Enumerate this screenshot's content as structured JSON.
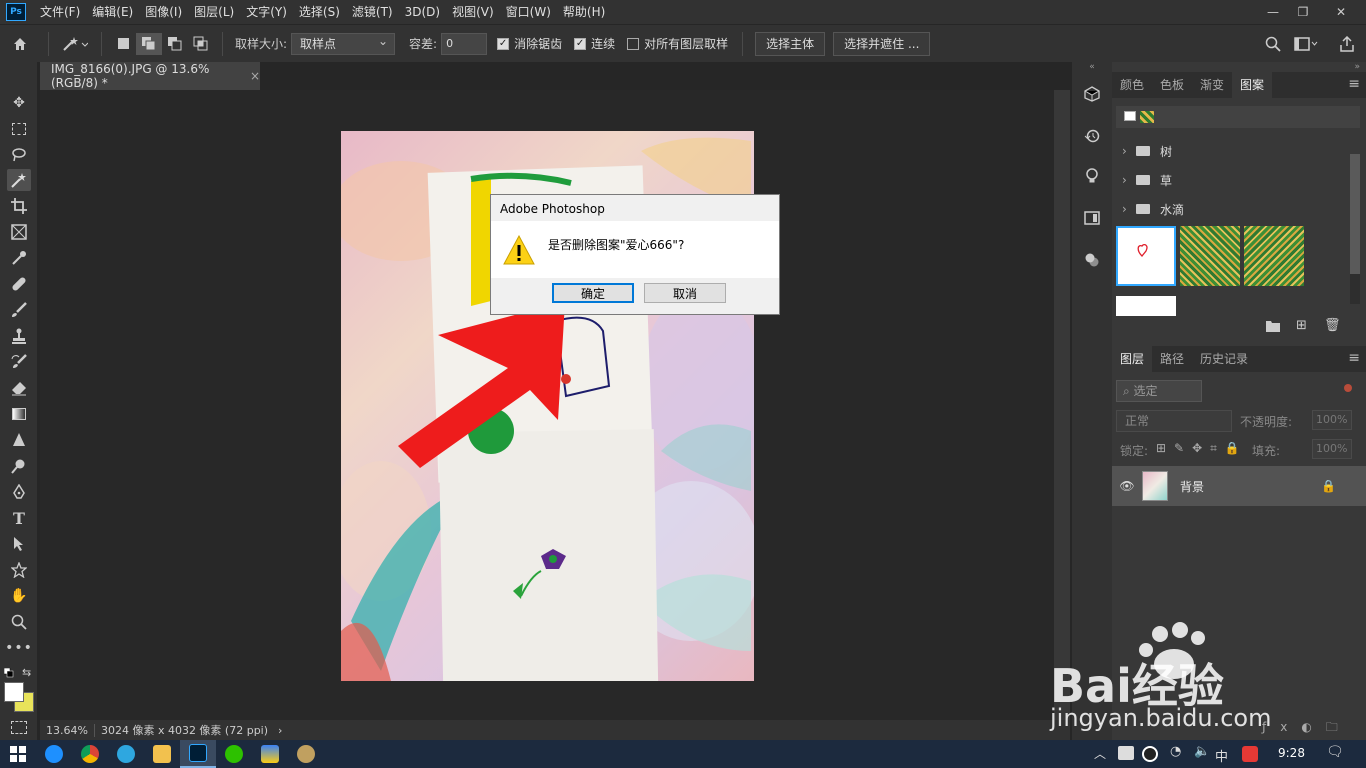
{
  "app": {
    "logo": "Ps"
  },
  "menu": [
    "文件(F)",
    "编辑(E)",
    "图像(I)",
    "图层(L)",
    "文字(Y)",
    "选择(S)",
    "滤镜(T)",
    "3D(D)",
    "视图(V)",
    "窗口(W)",
    "帮助(H)"
  ],
  "options": {
    "sample_size_label": "取样大小:",
    "sample_size_value": "取样点",
    "tolerance_label": "容差:",
    "tolerance_value": "0",
    "antialias_label": "消除锯齿",
    "contiguous_label": "连续",
    "all_layers_label": "对所有图层取样",
    "select_subject": "选择主体",
    "select_mask": "选择并遮住 ..."
  },
  "document": {
    "tab_title": "IMG_8166(0).JPG @ 13.6%(RGB/8) *",
    "close": "×"
  },
  "status": {
    "zoom": "13.64%",
    "info": "3024 像素 x 4032 像素 (72 ppi)",
    "more": "›"
  },
  "patterns_panel": {
    "tabs": [
      "颜色",
      "色板",
      "渐变",
      "图案"
    ],
    "active_tab": "图案",
    "folders": [
      "树",
      "草",
      "水滴"
    ]
  },
  "layers_panel": {
    "tabs": [
      "图层",
      "路径",
      "历史记录"
    ],
    "search_placeholder": "选定",
    "blend_mode": "正常",
    "opacity_label": "不透明度:",
    "opacity_value": "100%",
    "lock_label": "锁定:",
    "fill_label": "填充:",
    "fill_value": "100%",
    "layer_name": "背景"
  },
  "dialog": {
    "title": "Adobe Photoshop",
    "message": "是否删除图案\"爱心666\"?",
    "ok": "确定",
    "cancel": "取消"
  },
  "taskbar": {
    "ime": "中",
    "clock": "9:28"
  },
  "watermark": {
    "text": "Bai经验",
    "url": "jingyan.baidu.com"
  },
  "colors": {
    "accent": "#31a8ff",
    "arrow": "#ee1c1c",
    "dialog_focus": "#0078d7"
  }
}
